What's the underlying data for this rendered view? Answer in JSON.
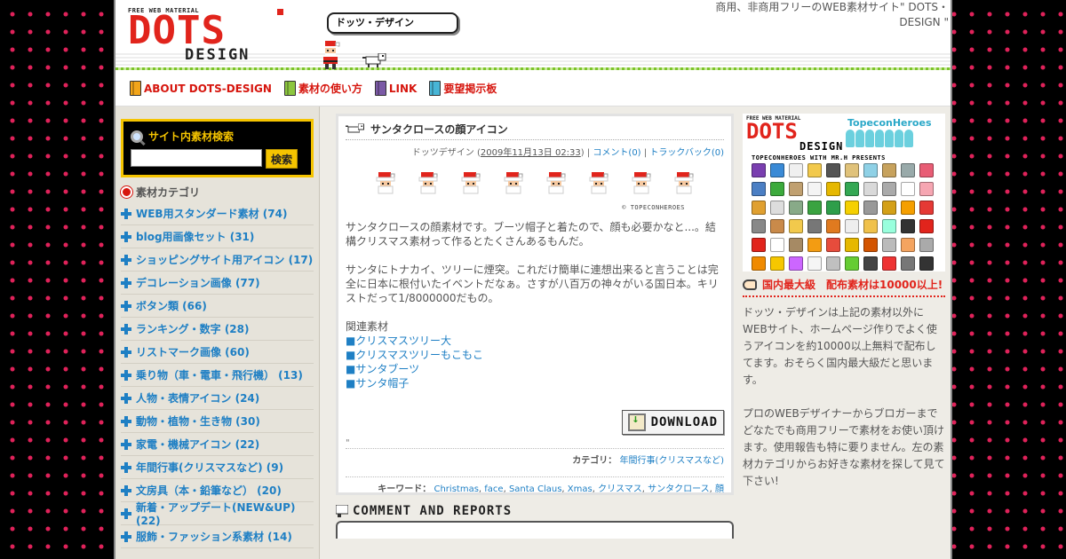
{
  "header": {
    "logo_small": "FREE WEB MATERIAL",
    "logo_main": "DOTS",
    "logo_sub": "DESIGN",
    "bubble": "ドッツ・デザイン",
    "tagline": "商用、非商用フリーのWEB素材サイト\" DOTS・DESIGN \""
  },
  "nav": {
    "items": [
      {
        "label": "ABOUT DOTS-DESIGN",
        "color": "#f2a51a"
      },
      {
        "label": "素材の使い方",
        "color": "#8cc63f"
      },
      {
        "label": "LINK",
        "color": "#7b5aa6"
      },
      {
        "label": "要望掲示板",
        "color": "#48b5d6"
      }
    ]
  },
  "sidebar": {
    "search_title": "サイト内素材検索",
    "search_value": "",
    "search_button": "検索",
    "category_heading": "素材カテゴリ",
    "categories": [
      "WEB用スタンダード素材 (74)",
      "blog用画像セット (31)",
      "ショッピングサイト用アイコン (17)",
      "デコレーション画像 (77)",
      "ボタン類 (66)",
      "ランキング・数字 (28)",
      "リストマーク画像 (60)",
      "乗り物（車・電車・飛行機） (13)",
      "人物・表情アイコン (24)",
      "動物・植物・生き物 (30)",
      "家電・機械アイコン (22)",
      "年間行事(クリスマスなど) (9)",
      "文房具（本・鉛筆など） (20)",
      "新着・アップデート(NEW&UP) (22)",
      "服飾・ファッション系素材 (14)"
    ]
  },
  "article": {
    "title": "サンタクロースの顔アイコン",
    "author": "ドッツデザイン",
    "date": "2009年11月13日 02:33",
    "comments": "コメント(0)",
    "trackbacks": "トラックバック(0)",
    "icon_credit": "© TOPECONHEROES",
    "paragraph1": "サンタクロースの顔素材です。ブーツ帽子と着たので、顔も必要かなと...。結構クリスマス素材って作るとたくさんあるもんだ。",
    "paragraph2": "サンタにトナカイ、ツリーに煙突。これだけ簡単に連想出来ると言うことは完全に日本に根付いたイベントだなぁ。さすが八百万の神々がいる国日本。キリストだって1/8000000だもの。",
    "related_title": "関連素材",
    "related": [
      "■クリスマスツリー大",
      "■クリスマスツリーもこもこ",
      "■サンタブーツ",
      "■サンタ帽子"
    ],
    "download": "DOWNLOAD",
    "stray_mark": "\"",
    "category_label": "カテゴリ：",
    "category_value": "年間行事(クリスマスなど)",
    "keyword_label": "キーワード：",
    "keywords": [
      "Christmas",
      "face",
      "Santa Claus",
      "Xmas",
      "クリスマス",
      "サンタクロース",
      "顔"
    ]
  },
  "comments_heading": "COMMENT AND REPORTS",
  "right": {
    "promo_small": "FREE WEB MATERIAL",
    "promo_logo": "DOTS",
    "promo_design": "DESIGN",
    "topecon": "TopeconHeroes",
    "presents": "TOPECONHEROES WITH MR.H PRESENTS",
    "biggest": "国内最大級　配布素材は10000以上!",
    "text1": "ドッツ・デザインは上記の素材以外にWEBサイト、ホームページ作りでよく使うアイコンを約10000以上無料で配布してます。おそらく国内最大級だと思います。",
    "text2": "プロのWEBデザイナーからブロガーまでどなたでも商用フリーで素材をお使い頂けます。使用報告も特に要りません。左の素材カテゴリからお好きな素材を探して見て下さい!"
  },
  "colors": {
    "brand_red": "#e1241c",
    "link_blue": "#1e7fc4",
    "search_yellow": "#f5c400",
    "dot_pink": "#e0225a"
  }
}
